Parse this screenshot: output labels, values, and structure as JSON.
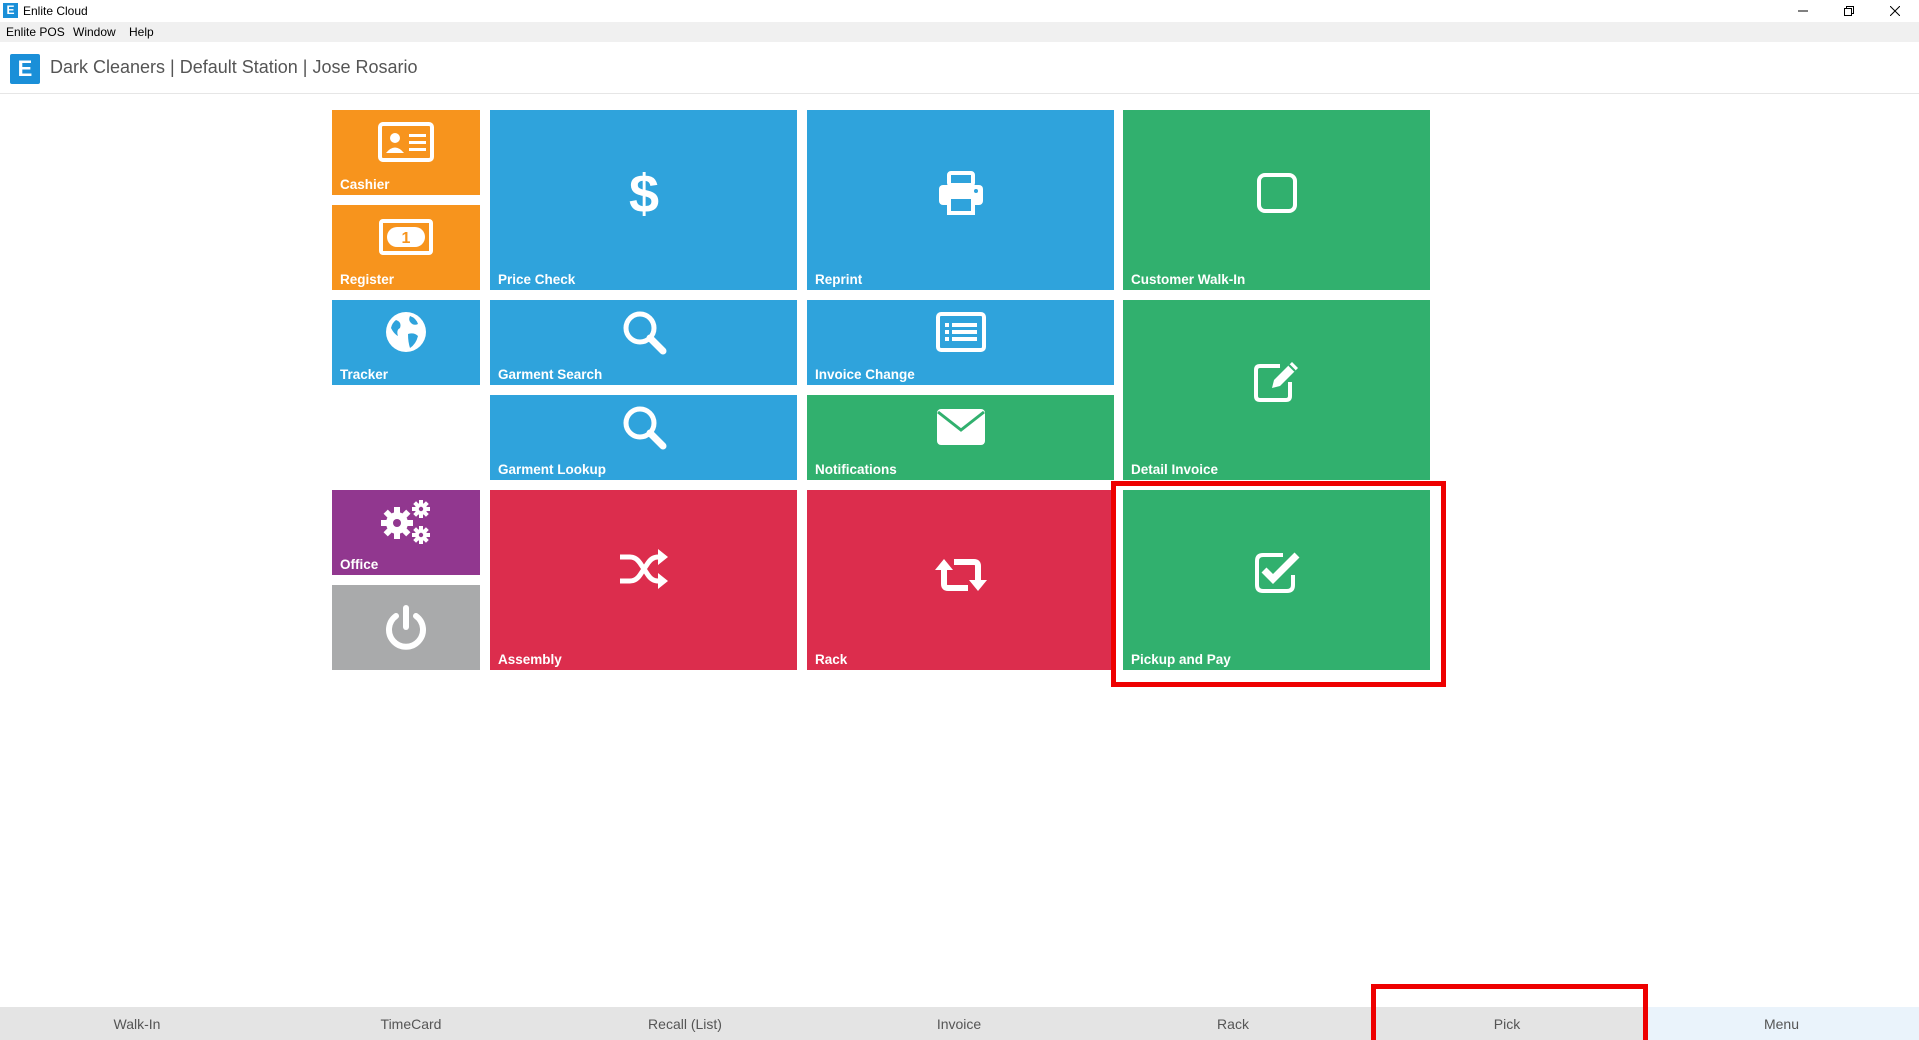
{
  "window": {
    "title": "Enlite Cloud",
    "icon_letter": "E"
  },
  "menu": [
    "Enlite POS",
    "Window",
    "Help"
  ],
  "header": {
    "logo_letter": "E",
    "title": "Dark Cleaners | Default Station | Jose Rosario"
  },
  "tiles": {
    "cashier": {
      "label": "Cashier",
      "icon": "id-card-icon"
    },
    "register": {
      "label": "Register",
      "icon": "money-bill-icon"
    },
    "price_check": {
      "label": "Price Check",
      "icon": "dollar-icon"
    },
    "reprint": {
      "label": "Reprint",
      "icon": "printer-icon"
    },
    "customer_walkin": {
      "label": "Customer Walk-In",
      "icon": "square-icon"
    },
    "tracker": {
      "label": "Tracker",
      "icon": "globe-icon"
    },
    "garment_search": {
      "label": "Garment Search",
      "icon": "search-icon"
    },
    "invoice_change": {
      "label": "Invoice Change",
      "icon": "list-icon"
    },
    "detail_invoice": {
      "label": "Detail Invoice",
      "icon": "edit-icon"
    },
    "garment_lookup": {
      "label": "Garment Lookup",
      "icon": "search-icon"
    },
    "notifications": {
      "label": "Notifications",
      "icon": "envelope-icon"
    },
    "office": {
      "label": "Office",
      "icon": "gears-icon"
    },
    "power": {
      "label": "",
      "icon": "power-icon"
    },
    "assembly": {
      "label": "Assembly",
      "icon": "shuffle-icon"
    },
    "rack": {
      "label": "Rack",
      "icon": "retweet-icon"
    },
    "pickup_pay": {
      "label": "Pickup and Pay",
      "icon": "check-square-icon"
    }
  },
  "colors": {
    "orange": "#f7941d",
    "blue": "#2fa3dc",
    "green": "#31b06e",
    "red": "#dc2d4d",
    "purple": "#91378f",
    "gray": "#a9aaab",
    "highlight": "#ee0000"
  },
  "bottom_nav": [
    "Walk-In",
    "TimeCard",
    "Recall (List)",
    "Invoice",
    "Rack",
    "Pick",
    "Menu"
  ]
}
